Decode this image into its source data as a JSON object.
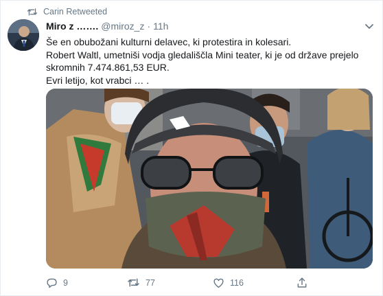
{
  "retweet": {
    "icon": "retweet-icon",
    "text": "Carin Retweeted"
  },
  "tweet": {
    "display_name": "Miro z …….",
    "handle": "@miroz_z",
    "separator": "·",
    "time": "11h",
    "lines": [
      "Še en obubožani kulturni delavec, ki protestira in kolesari.",
      "Robert Waltl, umetniši vodja gledališčla Mini teater, ki je od države prejelo",
      "skromnih 7.474.861,53 EUR.",
      "Evri letijo, kot vrabci … ."
    ]
  },
  "actions": {
    "reply_count": "9",
    "retweet_count": "77",
    "like_count": "116"
  },
  "colors": {
    "text": "#14171a",
    "secondary": "#657786",
    "border": "#e6ecf0"
  }
}
